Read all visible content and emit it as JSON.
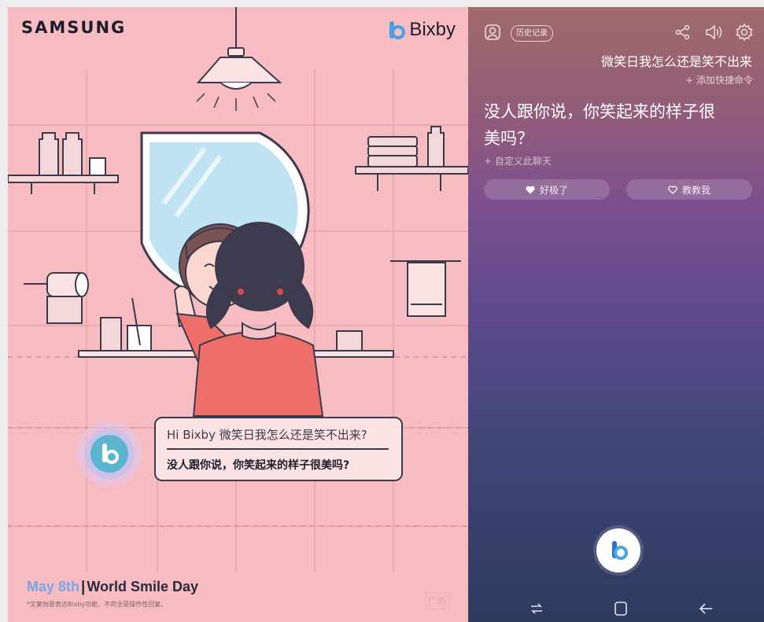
{
  "poster": {
    "brand": "SAMSUNG",
    "bixby_logo_text": "Bixby",
    "bubble_question": "Hi Bixby 微笑日我怎么还是笑不出来?",
    "bubble_answer": "没人跟你说，你笑起来的样子很美吗?",
    "tagline_date": "May 8th",
    "tagline_separator": "|",
    "tagline_event": "World Smile Day",
    "disclaimer": "*文案创意表达Bixby功能，不完全是操作性回复。",
    "ad_label": "广告",
    "colors": {
      "background": "#f7bcc1",
      "accent_blue": "#7aa6e8",
      "line": "#3b3a4d"
    }
  },
  "phone": {
    "history_label": "历史记录",
    "query": "微笑日我怎么还是笑不出来",
    "add_quick_command": "+ 添加快捷命令",
    "answer": "没人跟你说，你笑起来的样子很美吗？",
    "customize_chat": "+ 自定义此聊天",
    "like_label": "好极了",
    "teach_label": "教教我",
    "icons": [
      "profile-icon",
      "share-icon",
      "volume-icon",
      "settings-icon",
      "bixby-mic-icon",
      "recent-apps-icon",
      "home-icon",
      "back-icon"
    ]
  }
}
